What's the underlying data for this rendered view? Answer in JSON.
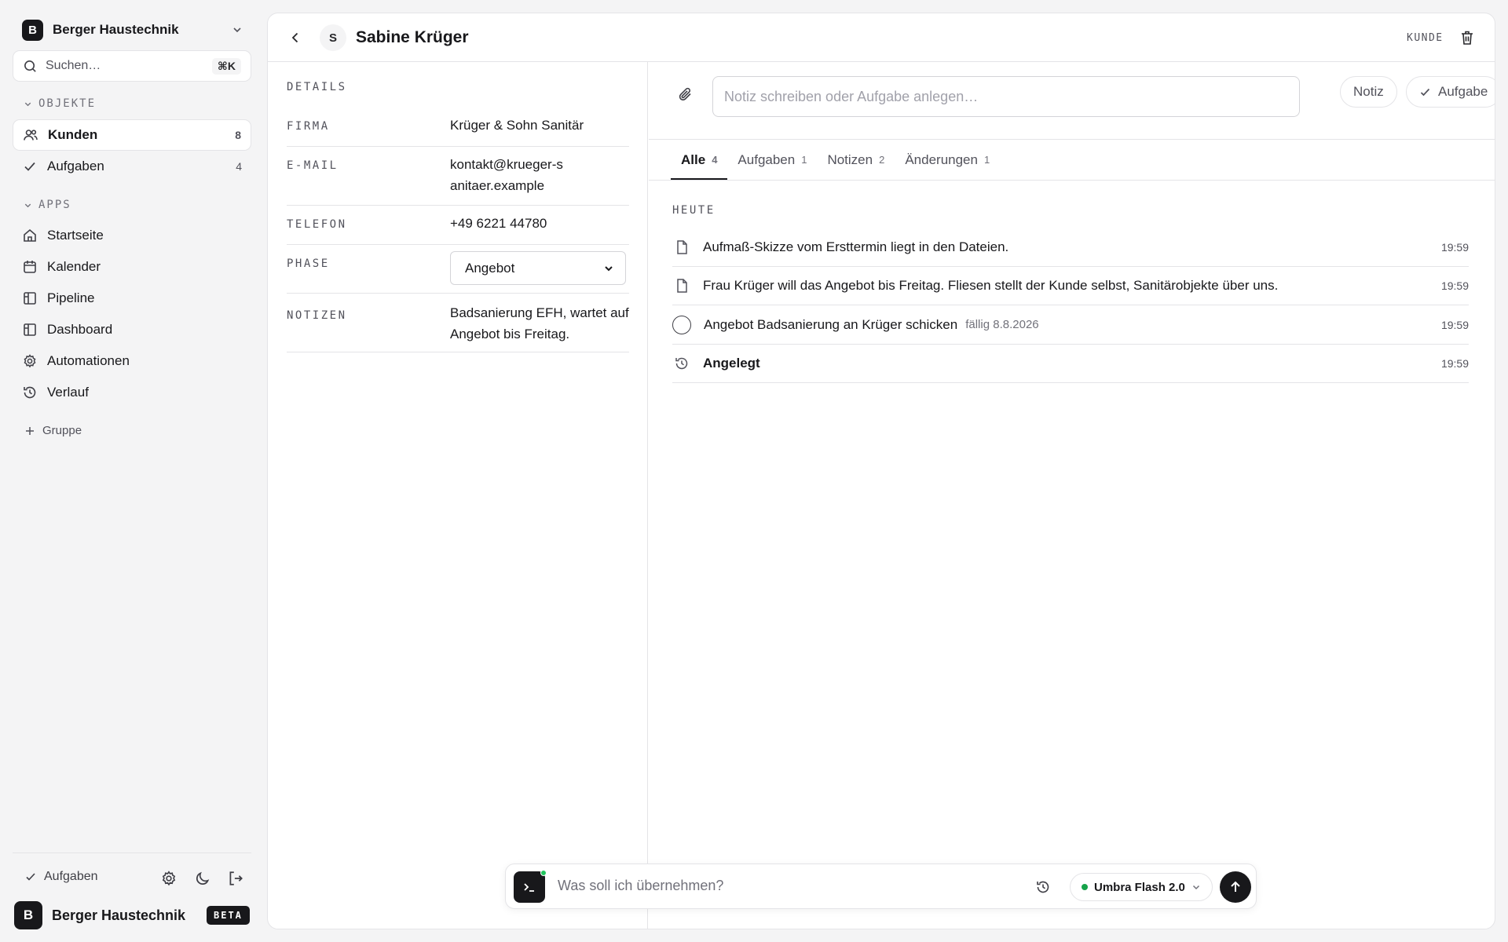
{
  "workspace": {
    "initial": "B",
    "name": "Berger Haustechnik"
  },
  "search": {
    "placeholder": "Suchen…",
    "shortcut": "⌘K"
  },
  "sidebar": {
    "objects_label": "OBJEKTE",
    "objects": [
      {
        "label": "Kunden",
        "count": "8",
        "icon": "users-icon",
        "active": true
      },
      {
        "label": "Aufgaben",
        "count": "4",
        "icon": "check-icon",
        "active": false
      }
    ],
    "apps_label": "APPS",
    "apps": [
      {
        "label": "Startseite",
        "icon": "home-icon"
      },
      {
        "label": "Kalender",
        "icon": "calendar-icon"
      },
      {
        "label": "Pipeline",
        "icon": "pipeline-icon"
      },
      {
        "label": "Dashboard",
        "icon": "dashboard-icon"
      },
      {
        "label": "Automationen",
        "icon": "gear-icon"
      },
      {
        "label": "Verlauf",
        "icon": "history-icon"
      }
    ],
    "add_group_label": "Gruppe",
    "footer_tasks_label": "Aufgaben",
    "badge": "BETA"
  },
  "record": {
    "avatar_initial": "S",
    "title": "Sabine Krüger",
    "type_label": "KUNDE",
    "details_title": "DETAILS",
    "fields": [
      {
        "key": "FIRMA",
        "value": "Krüger & Sohn Sanitär"
      },
      {
        "key": "E-MAIL",
        "value": "kontakt@krueger-sanitaer.example"
      },
      {
        "key": "TELEFON",
        "value": "+49 6221 44780"
      },
      {
        "key": "PHASE",
        "value": "Angebot"
      },
      {
        "key": "NOTIZEN",
        "value": "Badsanierung EFH, wartet auf Angebot bis Freitag."
      }
    ]
  },
  "composer": {
    "placeholder": "Notiz schreiben oder Aufgabe anlegen…",
    "note_button": "Notiz",
    "task_button": "Aufgabe"
  },
  "tabs": [
    {
      "label": "Alle",
      "count": "4",
      "active": true
    },
    {
      "label": "Aufgaben",
      "count": "1",
      "active": false
    },
    {
      "label": "Notizen",
      "count": "2",
      "active": false
    },
    {
      "label": "Änderungen",
      "count": "1",
      "active": false
    }
  ],
  "feed": {
    "day_label": "HEUTE",
    "items": [
      {
        "kind": "note",
        "text": "Aufmaß-Skizze vom Ersttermin liegt in den Dateien.",
        "time": "19:59"
      },
      {
        "kind": "note",
        "text": "Frau Krüger will das Angebot bis Freitag. Fliesen stellt der Kunde selbst, Sanitärobjekte über uns.",
        "time": "19:59"
      },
      {
        "kind": "task",
        "text": "Angebot Badsanierung an Krüger schicken",
        "due": "fällig 8.8.2026",
        "time": "19:59"
      },
      {
        "kind": "change",
        "text": "Angelegt",
        "time": "19:59"
      }
    ]
  },
  "ai_bar": {
    "placeholder": "Was soll ich übernehmen?",
    "model": "Umbra Flash 2.0"
  }
}
